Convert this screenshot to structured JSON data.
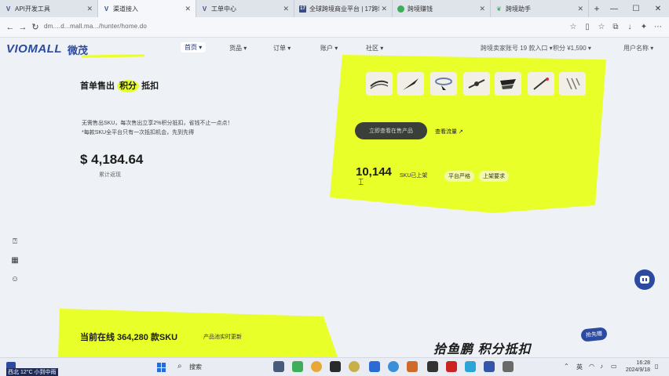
{
  "browser": {
    "tabs": [
      {
        "icon": "v-logo-icon",
        "title": "API开发工具",
        "active": false
      },
      {
        "icon": "v-logo-icon",
        "title": "渠道接入",
        "active": true
      },
      {
        "icon": "v-logo-icon",
        "title": "工单中心",
        "active": false
      },
      {
        "icon": "app-17-icon",
        "title": "全球跨境商业平台 | 17跨境",
        "active": false
      },
      {
        "icon": "dot-icon",
        "title": "跨境赚钱",
        "active": false
      },
      {
        "icon": "green-leaf-icon",
        "title": "跨境助手",
        "active": false
      }
    ],
    "url": "dm....d...mall.ma.../hunter/home.do"
  },
  "header": {
    "logo": "VIOMALL",
    "logo_cn": "微茂",
    "nav": [
      {
        "label": "首页 ▾",
        "active": true
      },
      {
        "label": "货品 ▾"
      },
      {
        "label": "订单 ▾"
      },
      {
        "label": "账户 ▾"
      },
      {
        "label": "社区 ▾"
      }
    ],
    "store_name": "跨境卖家账号 19 款入口 ▾",
    "points": "积分 ¥1,590 ▾",
    "user": "用户名称 ▾"
  },
  "hero": {
    "title_pre": "首单售出",
    "title_hl": "积分",
    "title_post": "抵扣",
    "desc_line1": "无需售出SKU，每次售出立享2%积分抵扣，省钱不止一点点！",
    "desc_line2": "*每款SKU全平台只有一次抵扣机会，先到先得",
    "revenue": "$ 4,184.64",
    "revenue_label": "累计返现"
  },
  "card": {
    "cta": "立即查看在售产品",
    "cases_link": "查看流量 ↗",
    "sku_count": "10,144",
    "sku_unit": "SKU已上架",
    "chip1": "平台严格",
    "chip2": "上架要求"
  },
  "online": {
    "title": "当前在线 364,280 款SKU",
    "subtitle": "产品池实时更新",
    "slogan": "拾鱼鹏 积分抵扣",
    "badge": "抢先赠"
  },
  "taskbar": {
    "weather_caption": "西北 12°C 小到中雨",
    "search": "搜索",
    "ime": "英",
    "time": "16:28",
    "date": "2024/9/18"
  },
  "colors": {
    "accent_yellow": "#e8ff2a",
    "brand_blue": "#2b4aa0",
    "bg": "#eef1f6"
  }
}
